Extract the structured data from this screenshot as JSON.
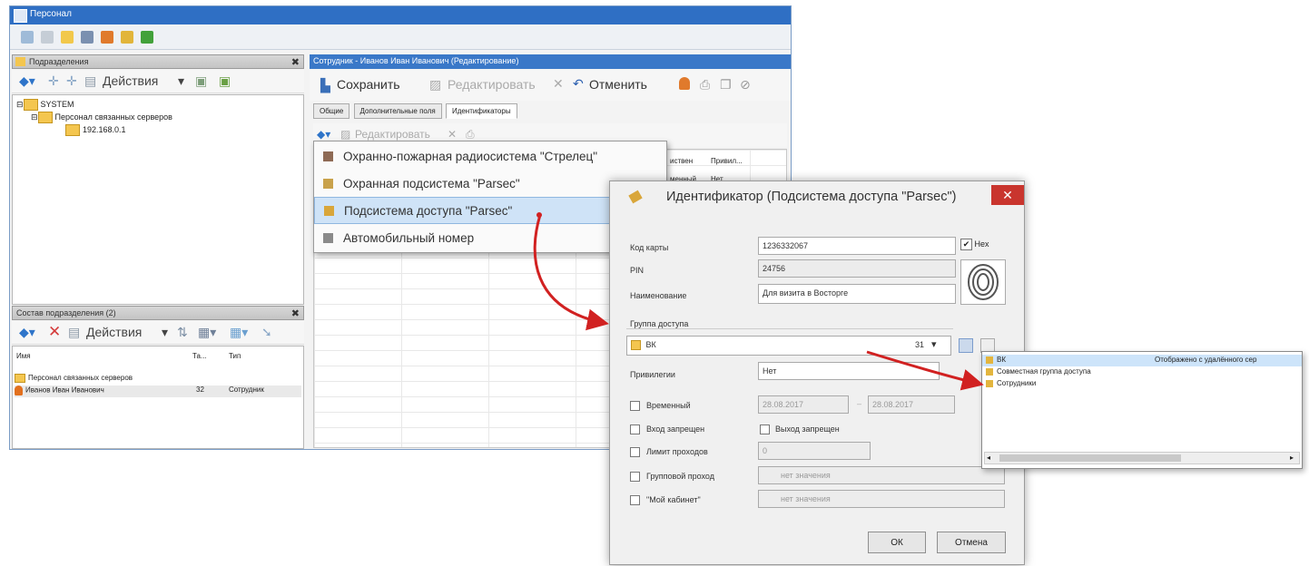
{
  "window": {
    "title": "Персонал"
  },
  "left_pane": {
    "title": "Подразделения",
    "actions_label": "Действия",
    "tree": [
      {
        "label": "SYSTEM"
      },
      {
        "label": "Персонал связанных серверов"
      },
      {
        "label": "192.168.0.1"
      }
    ]
  },
  "bottom_pane": {
    "title": "Состав подразделения (2)",
    "actions_label": "Действия",
    "columns": [
      "Имя",
      "Та...",
      "Тип"
    ],
    "rows": [
      {
        "name": "Персонал связанных серверов",
        "tab": "",
        "type": ""
      },
      {
        "name": "Иванов Иван Иванович",
        "tab": "32",
        "type": "Сотрудник"
      }
    ]
  },
  "employee": {
    "header": "Сотрудник - Иванов Иван Иванович (Редактирование)",
    "save_label": "Сохранить",
    "edit_label": "Редактировать",
    "cancel_label": "Отменить",
    "tabs": [
      "Общие",
      "Дополнительные поля",
      "Идентификаторы"
    ],
    "sub_edit_label": "Редактировать",
    "grid_headers": [
      "иствен",
      "Привил..."
    ],
    "grid_cells": [
      "менный",
      "Нет"
    ]
  },
  "add_menu": {
    "items": [
      "Охранно-пожарная радиосистема \"Стрелец\"",
      "Охранная подсистема \"Parsec\"",
      "Подсистема доступа \"Parsec\"",
      "Автомобильный номер"
    ]
  },
  "dialog": {
    "title": "Идентификатор (Подсистема доступа \"Parsec\")",
    "card_code_label": "Код карты",
    "card_code_value": "1236332067",
    "hex_label": "Hex",
    "pin_label": "PIN",
    "pin_value": "24756",
    "name_label": "Наименование",
    "name_value": "Для визита в Восторге",
    "access_group_label": "Группа доступа",
    "access_group_value": "ВК",
    "access_group_num": "31",
    "privileges_label": "Привилегии",
    "privileges_value": "Нет",
    "temporary_label": "Временный",
    "date_from": "28.08.2017",
    "date_to": "28.08.2017",
    "entry_forbidden_label": "Вход запрещен",
    "exit_forbidden_label": "Выход запрещен",
    "pass_limit_label": "Лимит проходов",
    "pass_limit_value": "0",
    "group_pass_label": "Групповой проход",
    "group_pass_value": "нет значения",
    "my_cabinet_label": "\"Мой кабинет\"",
    "my_cabinet_value": "нет значения",
    "ok_label": "ОК",
    "cancel_label": "Отмена"
  },
  "group_popup": {
    "items": [
      {
        "label": "ВК",
        "note": "Отображено с удалённого сер"
      },
      {
        "label": "Совместная группа доступа",
        "note": ""
      },
      {
        "label": "Сотрудники",
        "note": ""
      }
    ]
  },
  "colors": {
    "accent": "#2f6fc4",
    "arrow": "#d12121",
    "close": "#c9352e"
  }
}
